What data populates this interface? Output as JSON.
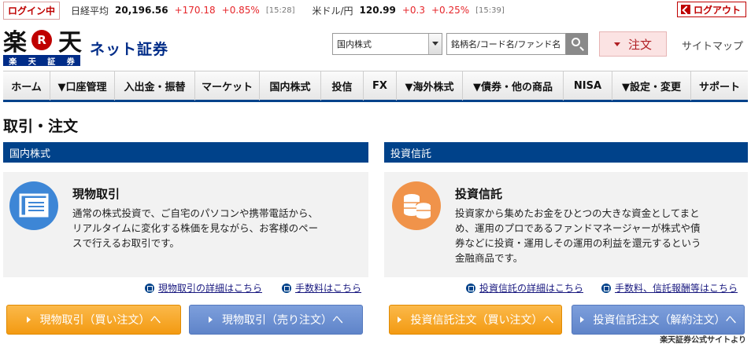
{
  "ticker": {
    "login_status": "ログイン中",
    "nikkei_label": "日経平均",
    "nikkei_value": "20,196.56",
    "nikkei_change": "+170.18",
    "nikkei_pct": "+0.85%",
    "nikkei_time": "[15:28]",
    "usdjpy_label": "米ドル/円",
    "usdjpy_value": "120.99",
    "usdjpy_change": "+0.3",
    "usdjpy_pct": "+0.25%",
    "usdjpy_time": "[15:39]",
    "logout_label": "ログアウト"
  },
  "header": {
    "logo_main": "楽天",
    "logo_r": "R",
    "logo_sub": [
      "楽",
      "天",
      "証",
      "券"
    ],
    "brand_name": "ネット証券",
    "market_select_value": "国内株式",
    "search_placeholder": "銘柄名/コード名/ファンド名",
    "order_label": "注文",
    "sitemap_label": "サイトマップ"
  },
  "nav": {
    "items": [
      {
        "label": "ホーム"
      },
      {
        "label": "▼口座管理"
      },
      {
        "label": "入出金・振替"
      },
      {
        "label": "マーケット"
      },
      {
        "label": "国内株式"
      },
      {
        "label": "投信"
      },
      {
        "label": "FX"
      },
      {
        "label": "▼海外株式"
      },
      {
        "label": "▼債券・他の商品"
      },
      {
        "label": "NISA"
      },
      {
        "label": "▼設定・変更"
      },
      {
        "label": "サポート"
      }
    ]
  },
  "page": {
    "title": "取引・注文",
    "footer_note": "楽天証券公式サイトより"
  },
  "sections": {
    "domestic": {
      "header": "国内株式",
      "card_title": "現物取引",
      "card_desc_lines": [
        "通常の株式投資で、ご自宅のパソコンや携帯電話から、",
        "リアルタイムに変化する株価を見ながら、お客様のペー",
        "スで行えるお取引です。"
      ],
      "link_details": "現物取引の詳細はこちら",
      "link_fees": "手数料はこちら",
      "btn_buy": "現物取引（買い注文）へ",
      "btn_sell": "現物取引（売り注文）へ",
      "icon_color": "#3d86d6"
    },
    "fund": {
      "header": "投資信託",
      "card_title": "投資信託",
      "card_desc_lines": [
        "投資家から集めたお金をひとつの大きな資金としてまと",
        "め、運用のプロであるファンドマネージャーが株式や債",
        "券などに投資・運用しその運用の利益を還元するという",
        "金融商品です。"
      ],
      "link_details": "投資信託の詳細はこちら",
      "link_fees": "手数料、信託報酬等はこちら",
      "btn_buy": "投資信託注文（買い注文）へ",
      "btn_sell": "投資信託注文（解約注文）へ",
      "icon_color": "#f0934a"
    }
  },
  "colors": {
    "brand_red": "#bf0000",
    "brand_navy": "#00428a",
    "up_red": "#e6262b",
    "button_orange": "#f5a623",
    "button_blue": "#6b8fd0"
  },
  "icons": {
    "logout": "logout-icon",
    "search": "search-icon",
    "order_caret": "caret-down-icon",
    "domestic_card": "document-icon",
    "fund_card": "coins-icon",
    "link": "window-link-icon",
    "button_arrow": "triangle-right-icon"
  }
}
